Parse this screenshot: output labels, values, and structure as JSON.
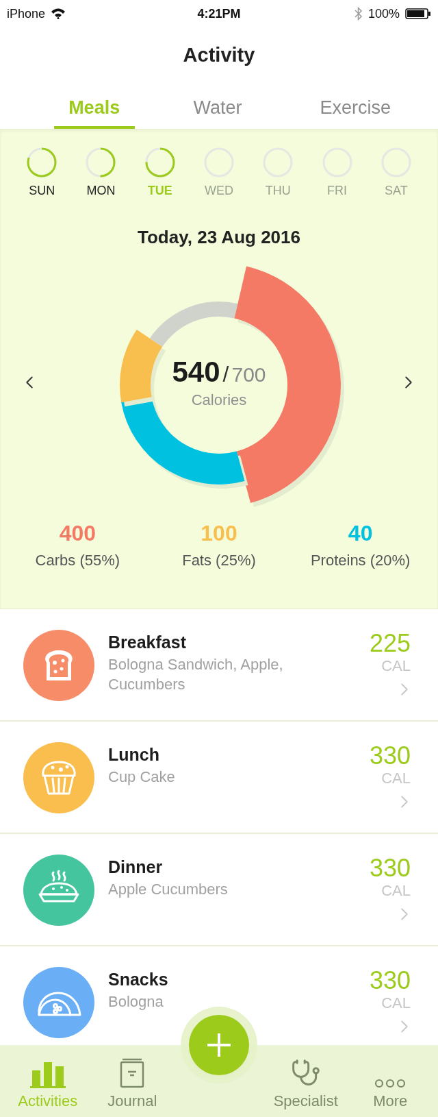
{
  "status_bar": {
    "carrier": "iPhone",
    "time": "4:21PM",
    "battery": "100%"
  },
  "title": "Activity",
  "tabs": [
    {
      "label": "Meals",
      "selected": true
    },
    {
      "label": "Water",
      "selected": false
    },
    {
      "label": "Exercise",
      "selected": false
    }
  ],
  "days": [
    {
      "label": "SUN",
      "selected": false,
      "disabled": false
    },
    {
      "label": "MON",
      "selected": false,
      "disabled": false
    },
    {
      "label": "TUE",
      "selected": true,
      "disabled": false
    },
    {
      "label": "WED",
      "selected": false,
      "disabled": true
    },
    {
      "label": "THU",
      "selected": false,
      "disabled": true
    },
    {
      "label": "FRI",
      "selected": false,
      "disabled": true
    },
    {
      "label": "SAT",
      "selected": false,
      "disabled": true
    }
  ],
  "date": "Today, 23 Aug 2016",
  "calories": {
    "eaten": "540",
    "separator": "/",
    "goal": "700",
    "label": "Calories"
  },
  "macros": [
    {
      "value": "400",
      "label": "Carbs (55%)",
      "color": "#f47a66"
    },
    {
      "value": "100",
      "label": "Fats (25%)",
      "color": "#f8bf4e"
    },
    {
      "value": "40",
      "label": "Proteins (20%)",
      "color": "#00c2e0"
    }
  ],
  "meals": [
    {
      "name": "Breakfast",
      "items": "Bologna Sandwich, Apple, Cucumbers",
      "calories": "225",
      "unit": "CAL",
      "kind": "bread",
      "color": "#f78c68"
    },
    {
      "name": "Lunch",
      "items": "Cup Cake",
      "calories": "330",
      "unit": "CAL",
      "kind": "muffin",
      "color": "#f9be4d"
    },
    {
      "name": "Dinner",
      "items": "Apple Cucumbers",
      "calories": "330",
      "unit": "CAL",
      "kind": "pie",
      "color": "#45c59e"
    },
    {
      "name": "Snacks",
      "items": "Bologna",
      "calories": "330",
      "unit": "CAL",
      "kind": "taco",
      "color": "#6aaef5"
    }
  ],
  "nav": [
    {
      "label": "Activities",
      "kind": "chart",
      "selected": true
    },
    {
      "label": "Journal",
      "kind": "book",
      "selected": false
    },
    {
      "label": "Specialist",
      "kind": "stethoscope",
      "selected": false
    },
    {
      "label": "More",
      "kind": "more",
      "selected": false
    }
  ]
}
